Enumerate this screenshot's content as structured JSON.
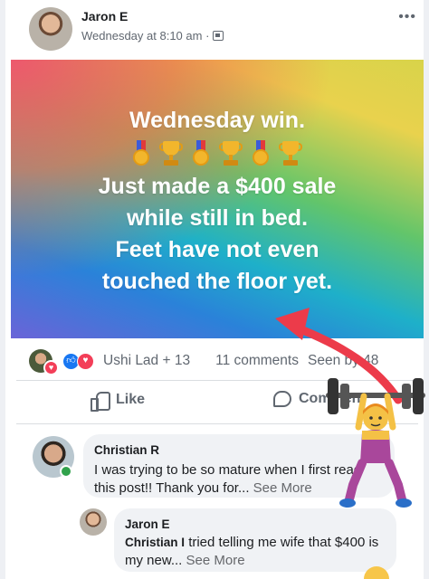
{
  "post": {
    "author": "Jaron E",
    "timestamp": "Wednesday at 8:10 am ·",
    "more": "•••"
  },
  "banner": {
    "line1": "Wednesday win.",
    "line2": "Just made a $400 sale",
    "line3": "while still in bed.",
    "line4": "Feet have not even",
    "line5": "touched the floor yet."
  },
  "reactions": {
    "names": "Ushi Lad + 13",
    "comments": "11 comments",
    "seen_by": "Seen by 48"
  },
  "actions": {
    "like": "Like",
    "comment": "Comment"
  },
  "comments": [
    {
      "name": "Christian R",
      "text": "I was trying to be so mature when I first read this post!! Thank you for...",
      "see_more": "See More"
    },
    {
      "name": "Jaron E",
      "text_name": "Christian I",
      "text": "tried telling me wife that $400 is my new...",
      "see_more": "See More"
    }
  ],
  "colors": {
    "like_blue": "#1877f2",
    "love_red": "#f33e58",
    "annotation_arrow": "#ec3b4a",
    "online_green": "#31a24c"
  },
  "icons": [
    "privacy-icon",
    "like-icon",
    "comment-icon",
    "medal-icon",
    "trophy-icon",
    "heart-icon",
    "arrow-annotation",
    "weightlifter-emoji"
  ]
}
